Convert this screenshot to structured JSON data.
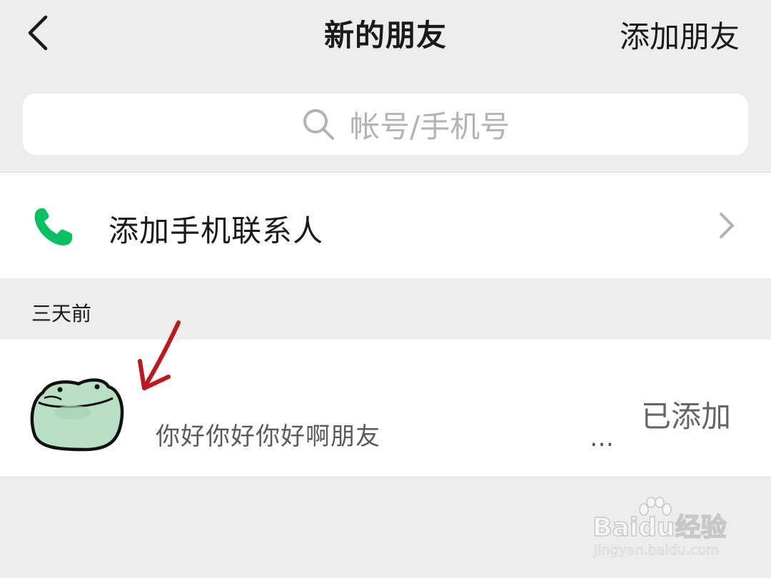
{
  "header": {
    "title": "新的朋友",
    "action_label": "添加朋友",
    "back_icon": "chevron-left-icon"
  },
  "search": {
    "placeholder": "帐号/手机号",
    "icon": "search-icon"
  },
  "phone_contacts": {
    "label": "添加手机联系人",
    "icon": "phone-icon",
    "icon_color": "#07c160"
  },
  "sections": [
    {
      "header": "三天前",
      "items": [
        {
          "message": "你好你好你好啊朋友",
          "ellipsis": "…",
          "status": "已添加"
        }
      ]
    }
  ],
  "colors": {
    "background": "#ededed",
    "card": "#ffffff",
    "annotation_arrow": "#c0171c",
    "avatar_fill": "#b9dfc4"
  },
  "watermark": {
    "logo": "Baidu经验",
    "url": "jingyan.baidu.com"
  }
}
